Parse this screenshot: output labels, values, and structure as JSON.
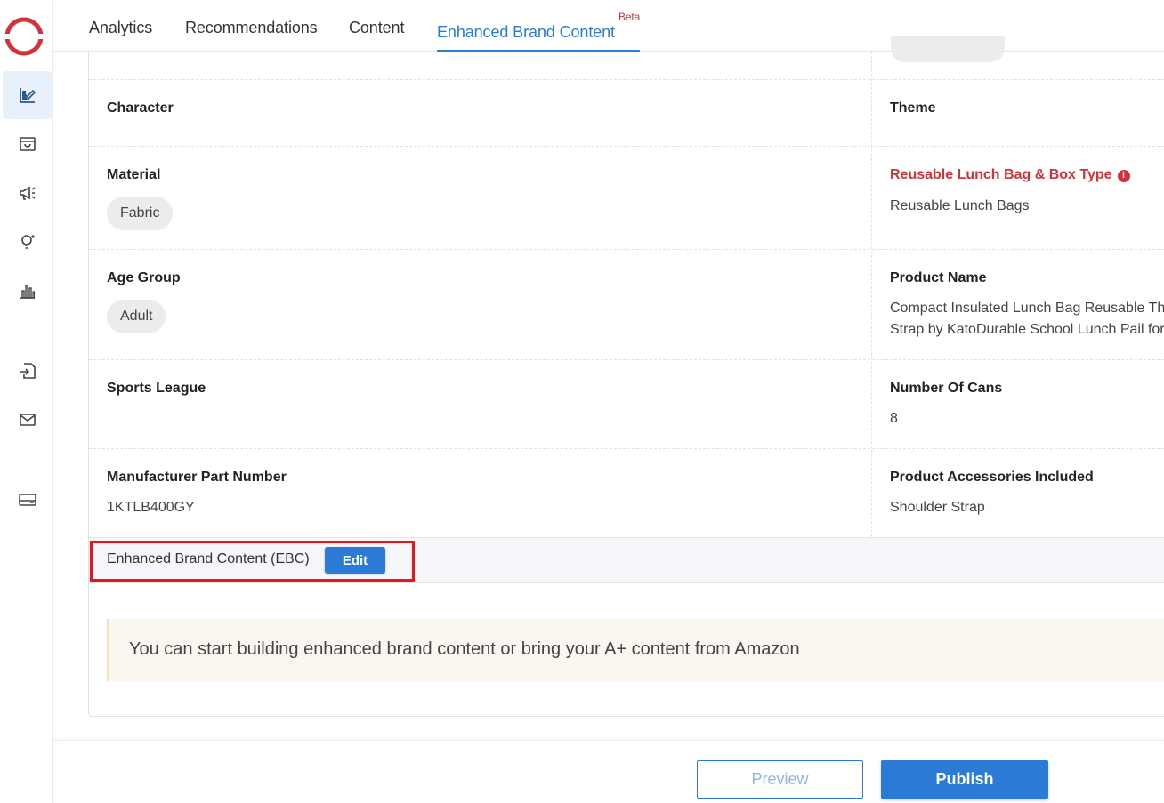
{
  "sidebar": {
    "logo": "brand-logo-icon",
    "items": [
      {
        "name": "product-content-icon",
        "active": true
      },
      {
        "name": "shopping-bag-icon",
        "active": false
      },
      {
        "name": "megaphone-icon",
        "active": false
      },
      {
        "name": "lightbulb-icon",
        "active": false
      },
      {
        "name": "bar-chart-icon",
        "active": false
      },
      {
        "name": "file-import-icon",
        "active": false
      },
      {
        "name": "mail-icon",
        "active": false
      },
      {
        "name": "wallet-icon",
        "active": false
      }
    ]
  },
  "tabs": [
    {
      "label": "Analytics"
    },
    {
      "label": "Recommendations"
    },
    {
      "label": "Content"
    },
    {
      "label": "Enhanced Brand Content",
      "badge": "Beta",
      "active": true
    }
  ],
  "attributes": {
    "character": {
      "label": "Character"
    },
    "theme": {
      "label": "Theme"
    },
    "material": {
      "label": "Material",
      "value": "Fabric"
    },
    "lunch_bag_type": {
      "label": "Reusable Lunch Bag & Box Type",
      "value": "Reusable Lunch Bags",
      "info_icon": "i"
    },
    "age_group": {
      "label": "Age Group",
      "value": "Adult"
    },
    "product_name": {
      "label": "Product Name",
      "value_line1": "Compact Insulated Lunch Bag Reusable Th",
      "value_line2": "Strap by KatoDurable School Lunch Pail for"
    },
    "sports_league": {
      "label": "Sports League"
    },
    "number_of_cans": {
      "label": "Number Of Cans",
      "value": "8"
    },
    "mpn": {
      "label": "Manufacturer Part Number",
      "value": "1KTLB400GY"
    },
    "accessories": {
      "label": "Product Accessories Included",
      "value": "Shoulder Strap"
    }
  },
  "ebc": {
    "label": "Enhanced Brand Content (EBC)",
    "edit_label": "Edit",
    "notice": "You can start building enhanced brand content or bring your A+ content from Amazon"
  },
  "footer": {
    "preview_label": "Preview",
    "publish_label": "Publish"
  },
  "colors": {
    "accent": "#2b7bd6",
    "required": "#d0343a",
    "highlight": "#e8141b"
  }
}
